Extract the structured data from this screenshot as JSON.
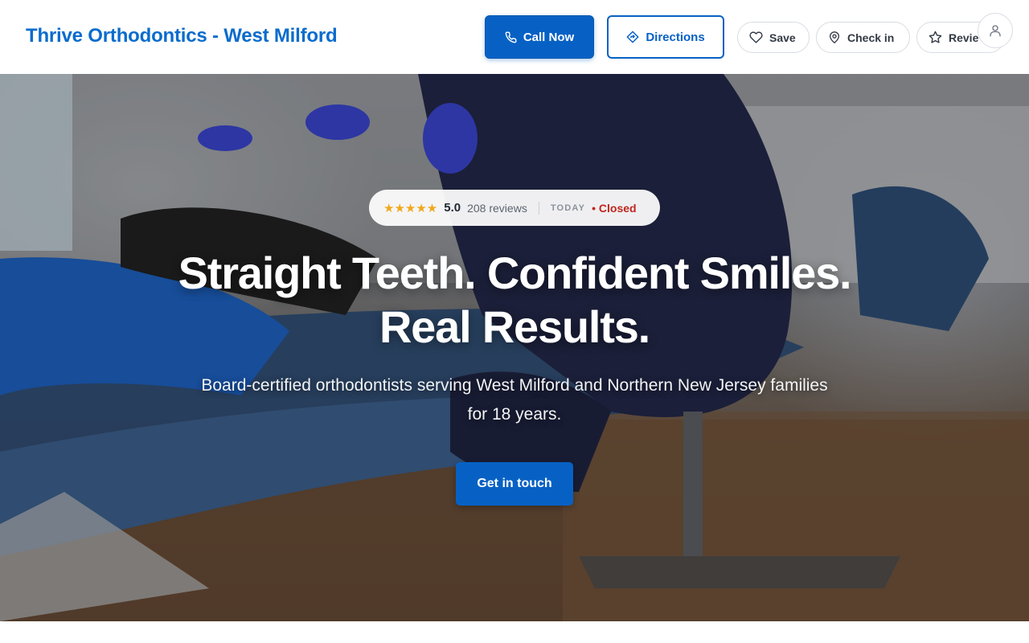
{
  "header": {
    "brand": "Thrive Orthodontics - West Milford",
    "call_label": "Call Now",
    "directions_label": "Directions",
    "save_label": "Save",
    "checkin_label": "Check in",
    "review_label": "Revie"
  },
  "hero": {
    "rating": {
      "stars": "★★★★★",
      "score": "5.0",
      "reviews": "208 reviews",
      "today_label": "TODAY",
      "status": "• Closed",
      "stars_value": 5
    },
    "headline_line1": "Straight Teeth. Confident Smiles.",
    "headline_line2": "Real Results.",
    "subtitle": "Board-certified orthodontists serving West Milford and Northern New Jersey families for 18 years.",
    "cta_label": "Get in touch"
  },
  "colors": {
    "brand_blue": "#0a6ccc",
    "button_blue": "#0761c4",
    "status_red": "#c0261d",
    "star_gold": "#f0a91c"
  },
  "icons": [
    "phone-icon",
    "directions-icon",
    "heart-icon",
    "map-pin-icon",
    "star-icon",
    "user-icon"
  ]
}
